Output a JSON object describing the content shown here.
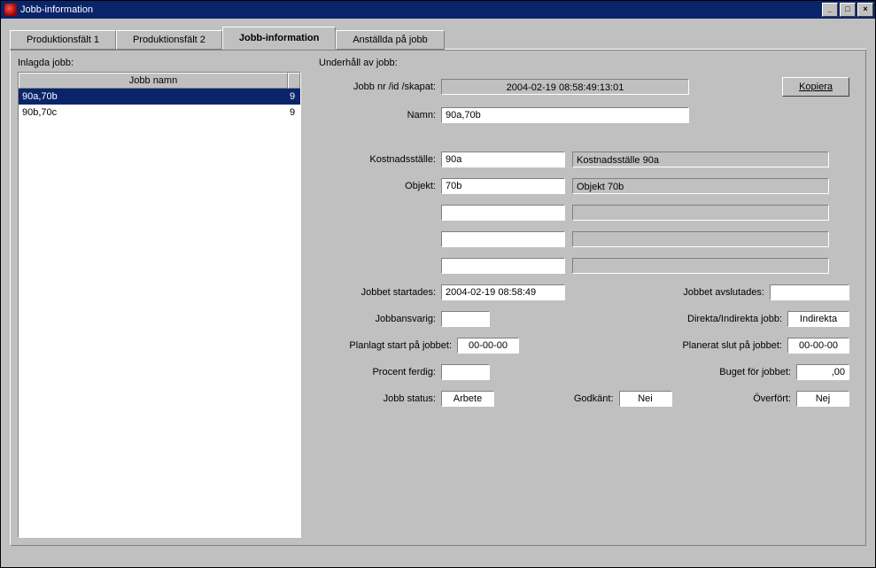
{
  "window": {
    "title": "Jobb-information"
  },
  "tabs": [
    {
      "label": "Produktionsfält 1"
    },
    {
      "label": "Produktionsfält 2"
    },
    {
      "label": "Jobb-information"
    },
    {
      "label": "Anställda på jobb"
    }
  ],
  "left": {
    "section_label": "Inlagda jobb:",
    "col_header": "Jobb namn",
    "rows": [
      {
        "name": "90a,70b",
        "flag": "9"
      },
      {
        "name": "90b,70c",
        "flag": "9"
      }
    ]
  },
  "right": {
    "section_label": "Underhåll av jobb:",
    "jobb_id_label": "Jobb nr /id /skapat:",
    "jobb_id_value": "2004-02-19 08:58:49:13:01",
    "copy_button": "Kopiera",
    "namn_label": "Namn:",
    "namn_value": "90a,70b",
    "kostnad_label": "Kostnadsställe:",
    "kostnad_value": "90a",
    "kostnad_desc": "Kostnadsställe 90a",
    "objekt_label": "Objekt:",
    "objekt_value": "70b",
    "objekt_desc": "Objekt 70b",
    "extra1_value": "",
    "extra1_desc": "",
    "extra2_value": "",
    "extra2_desc": "",
    "extra3_value": "",
    "extra3_desc": "",
    "start_label": "Jobbet startades:",
    "start_value": "2004-02-19 08:58:49",
    "end_label": "Jobbet avslutades:",
    "end_value": "",
    "ansvarig_label": "Jobbansvarig:",
    "ansvarig_value": "",
    "direkta_label": "Direkta/Indirekta jobb:",
    "direkta_value": "Indirekta",
    "plan_start_label": "Planlagt start på jobbet:",
    "plan_start_value": "00-00-00",
    "plan_slut_label": "Planerat slut på jobbet:",
    "plan_slut_value": "00-00-00",
    "procent_label": "Procent ferdig:",
    "procent_value": "",
    "budget_label": "Buget för jobbet:",
    "budget_value": ",00",
    "status_label": "Jobb status:",
    "status_value": "Arbete",
    "godk_label": "Godkänt:",
    "godk_value": "Nei",
    "over_label": "Överfört:",
    "over_value": "Nej"
  }
}
